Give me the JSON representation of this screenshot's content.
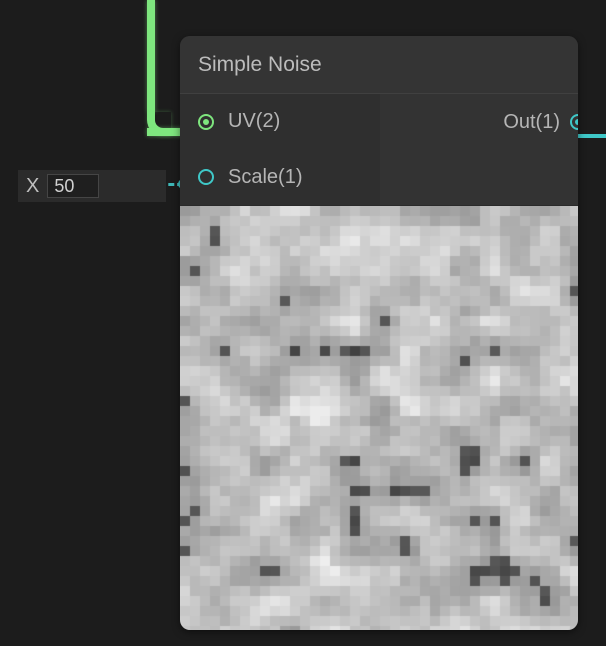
{
  "node": {
    "title": "Simple Noise",
    "inputs": [
      {
        "label": "UV(2)"
      },
      {
        "label": "Scale(1)"
      }
    ],
    "outputs": [
      {
        "label": "Out(1)"
      }
    ]
  },
  "floatNode": {
    "label": "X",
    "value": "50"
  },
  "colors": {
    "green": "#7ee67e",
    "teal": "#3fc8c8"
  }
}
